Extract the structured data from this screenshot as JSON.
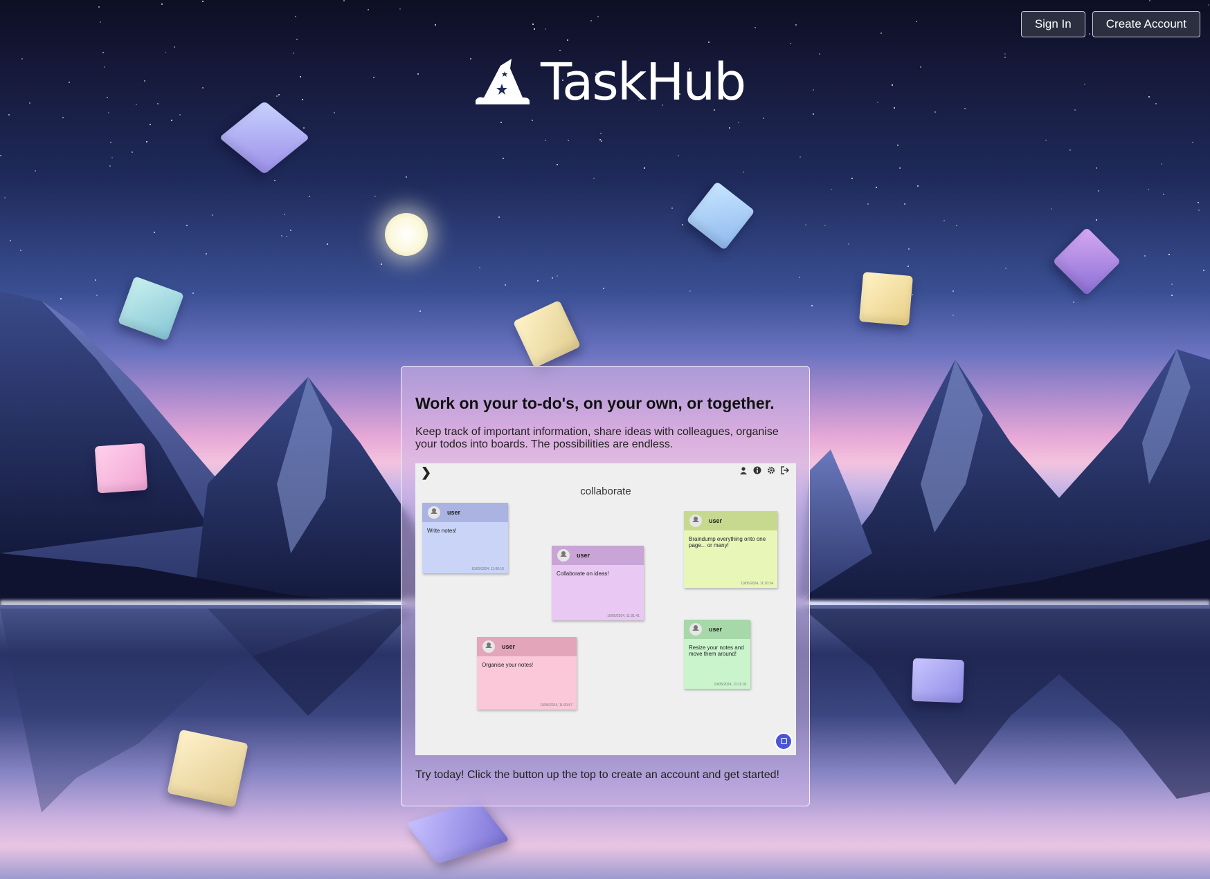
{
  "header": {
    "sign_in_label": "Sign In",
    "create_account_label": "Create Account"
  },
  "brand": {
    "name": "TaskHub",
    "logo_icon": "wizard-hat-icon"
  },
  "card": {
    "title": "Work on your to-do's, on your own, or together.",
    "description": "Keep track of important information, share ideas with colleagues, organise your todos into boards. The possibilities are endless.",
    "cta": "Try today! Click the button up the top to create an account and get started!"
  },
  "preview": {
    "board_title": "collaborate",
    "toolbar_icons": [
      "user-icon",
      "info-icon",
      "gear-icon",
      "logout-icon"
    ],
    "notes": [
      {
        "user": "user",
        "text": "Write notes!",
        "date": "10/05/2024, 11:00:10",
        "color": "#c9d4f7",
        "head": "#aab3e1"
      },
      {
        "user": "user",
        "text": "Collaborate on ideas!",
        "date": "10/05/2024, 11:01:41",
        "color": "#e9c8f3",
        "head": "#c9a4d7"
      },
      {
        "user": "user",
        "text": "Braindump everything onto one page... or many!",
        "date": "10/05/2024, 11:10:24",
        "color": "#e8f6b8",
        "head": "#c7d98f"
      },
      {
        "user": "user",
        "text": "Organise your notes!",
        "date": "10/05/2024, 11:00:57",
        "color": "#fbc8da",
        "head": "#e3a5ba"
      },
      {
        "user": "user",
        "text": "Resize your notes and move them around!",
        "date": "10/05/2024, 11:11:18",
        "color": "#c9f4cc",
        "head": "#a6d8a9"
      }
    ]
  },
  "colors": {
    "button_bg": "#2b2f40",
    "fab": "#4a55d6"
  }
}
